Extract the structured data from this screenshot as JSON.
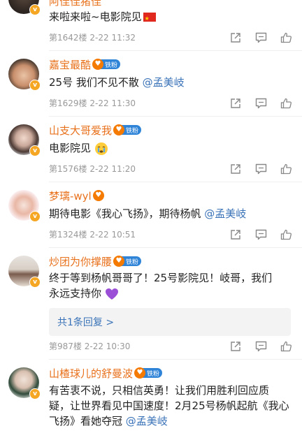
{
  "comments": [
    {
      "username": "阿佳佳猪佳",
      "content": "来啦来啦~电影院见",
      "emoji": "china-flag",
      "floor": "第1642楼",
      "date": "2-22",
      "time": "11:32"
    },
    {
      "username": "嘉宝最酷",
      "fan_label": "铁粉",
      "content": "25号 我们不见不散 ",
      "mention": "@孟美岐",
      "floor": "第1629楼",
      "date": "2-22",
      "time": "11:30"
    },
    {
      "username": "山支大哥爱我",
      "fan_label": "铁粉",
      "content": "电影院见",
      "emoji": "crying-face",
      "floor": "第1576楼",
      "date": "2-22",
      "time": "11:20"
    },
    {
      "username": "梦璃-wyl",
      "content": "期待电影《我心飞扬》，期待杨帆 ",
      "mention": "@孟美岐",
      "floor": "第1324楼",
      "date": "2-22",
      "time": "10:51"
    },
    {
      "username": "炒团为你撑腰",
      "fan_label": "铁粉",
      "content": "终于等到杨帆哥哥了！25号影院见！岐哥，我们永远支持你",
      "emoji": "purple-heart",
      "reply_link": "共1条回复 >",
      "floor": "第987楼",
      "date": "2-22",
      "time": "10:30"
    },
    {
      "username": "山楂球儿的舒曼波",
      "fan_label": "铁粉",
      "content": "有苦衷不说，只相信英勇！让我们用胜利回应质疑，让世界看见中国速度！2月25号杨帆起航《我心飞扬》看她夺冠 ",
      "mention": "@孟美岐"
    }
  ],
  "colors": {
    "username": "#e8711c",
    "mention": "#3a73b8",
    "meta": "#999999",
    "badge": "#f5a623",
    "fan_badge": "#2f84d8"
  },
  "icons": {
    "share": "share-icon",
    "comment": "comment-icon",
    "like": "like-icon"
  }
}
